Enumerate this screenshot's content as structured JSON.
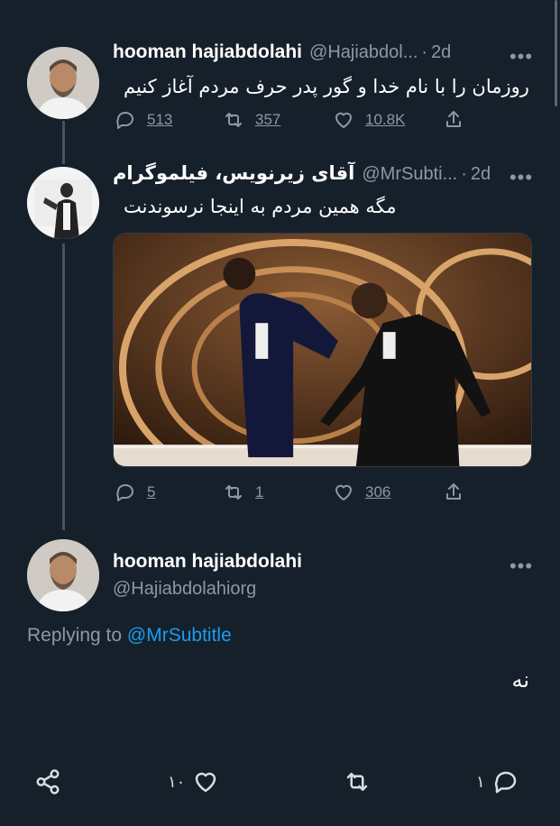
{
  "tweets": [
    {
      "name": "hooman hajiabdolahi",
      "handle": "@Hajiabdol...",
      "time": "2d",
      "text": "روزمان را با نام خدا و گور پدر حرف مردم آغاز کنیم",
      "replies": "513",
      "retweets": "357",
      "likes": "10.8K"
    },
    {
      "name": "آقای زیرنویس، فیلموگرام",
      "handle": "@MrSubti...",
      "time": "2d",
      "text": "مگه همین مردم به اینجا نرسوندنت",
      "replies": "5",
      "retweets": "1",
      "likes": "306"
    }
  ],
  "reply": {
    "name": "hooman hajiabdolahi",
    "handle": "@Hajiabdolahiorg",
    "replying_prefix": "Replying to",
    "replying_mention": "@MrSubtitle",
    "text": "نه"
  },
  "bottom_bar": {
    "likes": "۱۰",
    "replies": "۱"
  },
  "dot_sep": "·",
  "more_glyph": "•••",
  "colors": {
    "background": "#15202b",
    "muted": "#8b98a5",
    "accent": "#1d9bf0",
    "thread_line": "#3d5466"
  }
}
